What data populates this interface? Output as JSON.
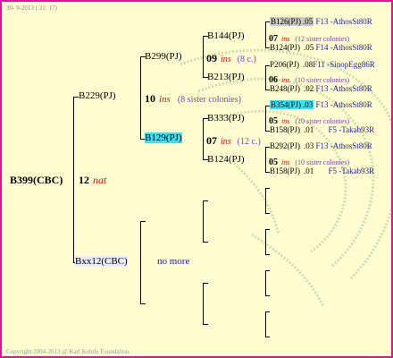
{
  "header": {
    "date": "30- 9-2013 ( 21: 17)"
  },
  "footer": {
    "copyright": "Copyright 2004-2013 @ Karl Kehrle Foundation."
  },
  "colors": {
    "border": "#e0148c",
    "background": "#fffdd0",
    "highlight_cyan": "#33e5f5",
    "highlight_gray": "#c8c8c8",
    "mark_red": "#d01010"
  },
  "root": {
    "label": "B399(CBC)",
    "gen_num": "12",
    "gen_mark": "nat"
  },
  "sire": {
    "label": "B229(PJ)",
    "gen_num": "10",
    "gen_mark": "ins",
    "colonies": "(8 sister colonies)"
  },
  "dam": {
    "label": "Bxx12(CBC)",
    "note": "no more"
  },
  "gs1": {
    "label": "B299(PJ)",
    "gen_num": "09",
    "gen_mark": "ins",
    "colonies": "(8 c.)"
  },
  "gs2": {
    "label": "B129(PJ)",
    "gen_num": "07",
    "gen_mark": "ins",
    "colonies": "(12 c.)"
  },
  "ggs1": {
    "label": "B144(PJ)",
    "gen_num": "07",
    "gen_mark": "ins",
    "colonies": "(12 sister colonies)"
  },
  "ggs2": {
    "label": "B213(PJ)",
    "gen_num": "06",
    "gen_mark": "ins",
    "colonies": "(10 sister colonies)"
  },
  "ggs3": {
    "label": "B333(PJ)",
    "gen_num": "05",
    "gen_mark": "ins",
    "colonies": "(10 sister colonies)"
  },
  "ggs4": {
    "label": "B124(PJ)",
    "gen_num": "05",
    "gen_mark": "ins",
    "colonies": "(10 sister colonies)"
  },
  "leaves": [
    {
      "label": "B126(PJ)",
      "num": ".05",
      "ref": "F13 -AthosSt80R"
    },
    {
      "label": "B124(PJ)",
      "num": ".05",
      "ref": "F14 -AthosSt80R"
    },
    {
      "label": "P206(PJ)",
      "num": ".08",
      "ref": "F11 -SinopEgg86R"
    },
    {
      "label": "B248(PJ)",
      "num": ".02",
      "ref": "F13 -AthosSt80R"
    },
    {
      "label": "B354(PJ)",
      "num": ".03",
      "ref": "F13 -AthosSt80R"
    },
    {
      "label": "B158(PJ)",
      "num": ".01",
      "ref": "F5 -Takab93R"
    },
    {
      "label": "B292(PJ)",
      "num": ".03",
      "ref": "F13 -AthosSt80R"
    },
    {
      "label": "B158(PJ)",
      "num": ".01",
      "ref": "F5 -Takab93R"
    }
  ]
}
